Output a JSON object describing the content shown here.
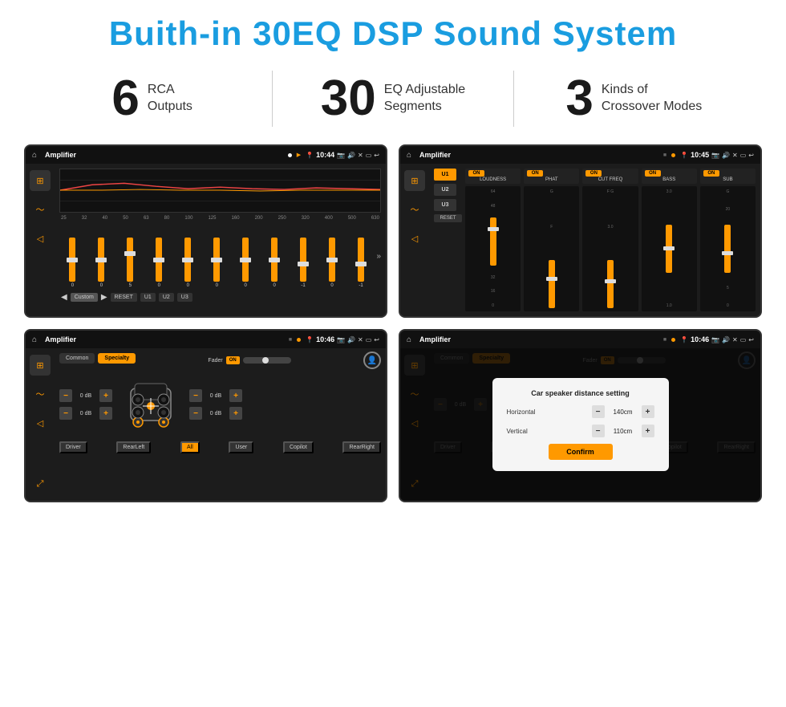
{
  "header": {
    "title": "Buith-in 30EQ DSP Sound System"
  },
  "stats": [
    {
      "number": "6",
      "label": "RCA\nOutputs"
    },
    {
      "number": "30",
      "label": "EQ Adjustable\nSegments"
    },
    {
      "number": "3",
      "label": "Kinds of\nCrossover Modes"
    }
  ],
  "screens": [
    {
      "id": "eq-screen",
      "status": {
        "title": "Amplifier",
        "time": "10:44"
      },
      "type": "equalizer",
      "freqs": [
        "25",
        "32",
        "40",
        "50",
        "63",
        "80",
        "100",
        "125",
        "160",
        "200",
        "250",
        "320",
        "400",
        "500",
        "630"
      ],
      "values": [
        "0",
        "0",
        "0",
        "5",
        "0",
        "0",
        "0",
        "0",
        "0",
        "0",
        "-1",
        "0",
        "-1"
      ],
      "preset": "Custom",
      "buttons": [
        "RESET",
        "U1",
        "U2",
        "U3"
      ]
    },
    {
      "id": "crossover-screen",
      "status": {
        "title": "Amplifier",
        "time": "10:45"
      },
      "type": "crossover",
      "presets": [
        "U1",
        "U2",
        "U3"
      ],
      "channels": [
        {
          "label": "LOUDNESS",
          "on": true
        },
        {
          "label": "PHAT",
          "on": true
        },
        {
          "label": "CUT FREQ",
          "on": true
        },
        {
          "label": "BASS",
          "on": true
        },
        {
          "label": "SUB",
          "on": true
        }
      ],
      "resetBtn": "RESET"
    },
    {
      "id": "fader-screen",
      "status": {
        "title": "Amplifier",
        "time": "10:46"
      },
      "type": "fader",
      "tabs": [
        "Common",
        "Specialty"
      ],
      "activeTab": "Specialty",
      "faderLabel": "Fader",
      "faderOn": "ON",
      "dbValues": [
        "0 dB",
        "0 dB",
        "0 dB",
        "0 dB"
      ],
      "buttons": [
        "Driver",
        "RearLeft",
        "All",
        "User",
        "Copilot",
        "RearRight"
      ]
    },
    {
      "id": "fader-dialog-screen",
      "status": {
        "title": "Amplifier",
        "time": "10:46"
      },
      "type": "fader-dialog",
      "tabs": [
        "Common",
        "Specialty"
      ],
      "activeTab": "Specialty",
      "dialog": {
        "title": "Car speaker distance setting",
        "fields": [
          {
            "label": "Horizontal",
            "value": "140cm"
          },
          {
            "label": "Vertical",
            "value": "110cm"
          }
        ],
        "confirmLabel": "Confirm"
      },
      "dbValues": [
        "0 dB",
        "0 dB"
      ],
      "buttons": [
        "Driver",
        "RearLeft",
        "All",
        "User",
        "Copilot",
        "RearRight"
      ]
    }
  ]
}
